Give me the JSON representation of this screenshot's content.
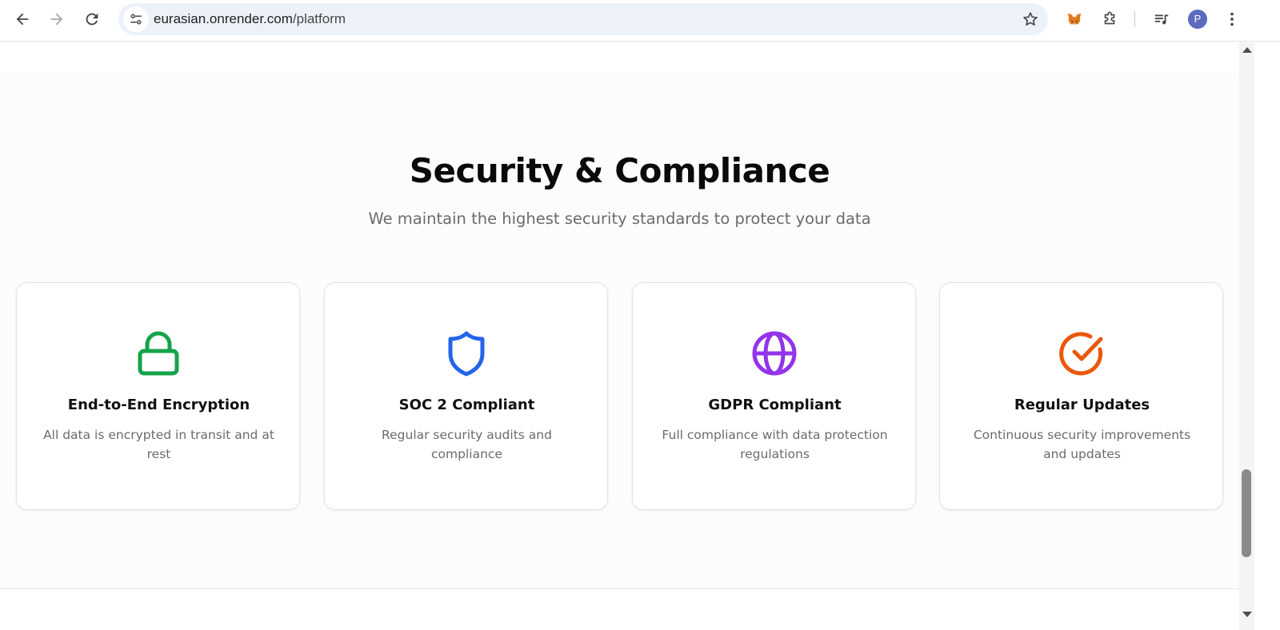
{
  "browser": {
    "url_host": "eurasian.onrender.com",
    "url_path": "/platform",
    "profile_initial": "P",
    "icons": [
      "back-icon",
      "forward-icon",
      "reload-icon",
      "site-settings-icon",
      "bookmark-star-icon",
      "metamask-fox-icon",
      "extensions-puzzle-icon",
      "media-playlist-icon",
      "more-vert-icon"
    ]
  },
  "section": {
    "title": "Security & Compliance",
    "subtitle": "We maintain the highest security standards to protect your data"
  },
  "cards": [
    {
      "icon": "lock-icon",
      "color": "#16a34a",
      "title": "End-to-End Encryption",
      "description": "All data is encrypted in transit and at rest"
    },
    {
      "icon": "shield-icon",
      "color": "#2563eb",
      "title": "SOC 2 Compliant",
      "description": "Regular security audits and compliance"
    },
    {
      "icon": "globe-icon",
      "color": "#9333ea",
      "title": "GDPR Compliant",
      "description": "Full compliance with data protection regulations"
    },
    {
      "icon": "check-circle-icon",
      "color": "#ea580c",
      "title": "Regular Updates",
      "description": "Continuous security improvements and updates"
    }
  ]
}
